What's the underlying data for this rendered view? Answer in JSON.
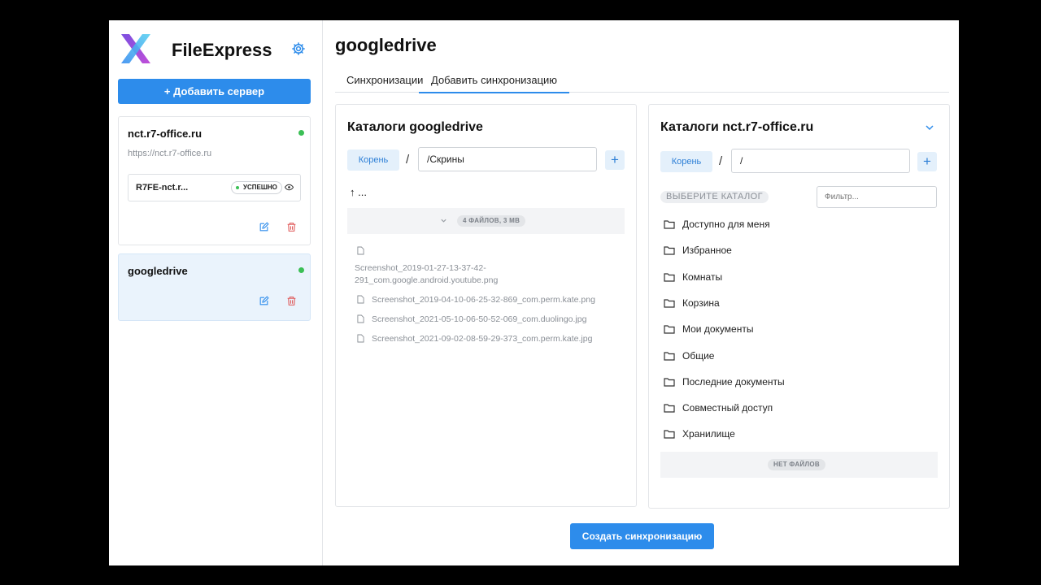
{
  "app": {
    "name": "FileExpress"
  },
  "sidebar": {
    "add_server_label": "+ Добавить сервер",
    "servers": [
      {
        "title": "nct.r7-office.ru",
        "url": "https://nct.r7-office.ru",
        "sync_name": "R7FE-nct.r...",
        "sync_status": "УСПЕШНО",
        "status_color": "#3bbf55"
      },
      {
        "title": "googledrive",
        "status_color": "#3bbf55"
      }
    ]
  },
  "main": {
    "title": "googledrive",
    "tabs": [
      {
        "label": "Синхронизации"
      },
      {
        "label": "Добавить синхронизацию",
        "active": true
      }
    ],
    "left_panel": {
      "title": "Каталоги googledrive",
      "root_label": "Корень",
      "separator": "/",
      "path_value": "/Скрины",
      "plus_label": "+",
      "up_label": "↑ ...",
      "files_summary": "4 ФАЙЛОВ, 3 MB",
      "files": [
        "Screenshot_2019-01-27-13-37-42-291_com.google.android.youtube.png",
        "Screenshot_2019-04-10-06-25-32-869_com.perm.kate.png",
        "Screenshot_2021-05-10-06-50-52-069_com.duolingo.jpg",
        "Screenshot_2021-09-02-08-59-29-373_com.perm.kate.jpg"
      ]
    },
    "right_panel": {
      "title": "Каталоги nct.r7-office.ru",
      "root_label": "Корень",
      "separator": "/",
      "path_value": "/",
      "plus_label": "+",
      "select_label": "ВЫБЕРИТЕ КАТАЛОГ",
      "filter_placeholder": "Фильтр...",
      "folders": [
        "Доступно для меня",
        "Избранное",
        "Комнаты",
        "Корзина",
        "Мои документы",
        "Общие",
        "Последние документы",
        "Совместный доступ",
        "Хранилище"
      ],
      "no_files_label": "НЕТ ФАЙЛОВ"
    },
    "create_button_label": "Создать синхронизацию"
  },
  "colors": {
    "accent": "#2d8ceb",
    "success": "#3bbf55",
    "danger": "#e05a5a"
  }
}
